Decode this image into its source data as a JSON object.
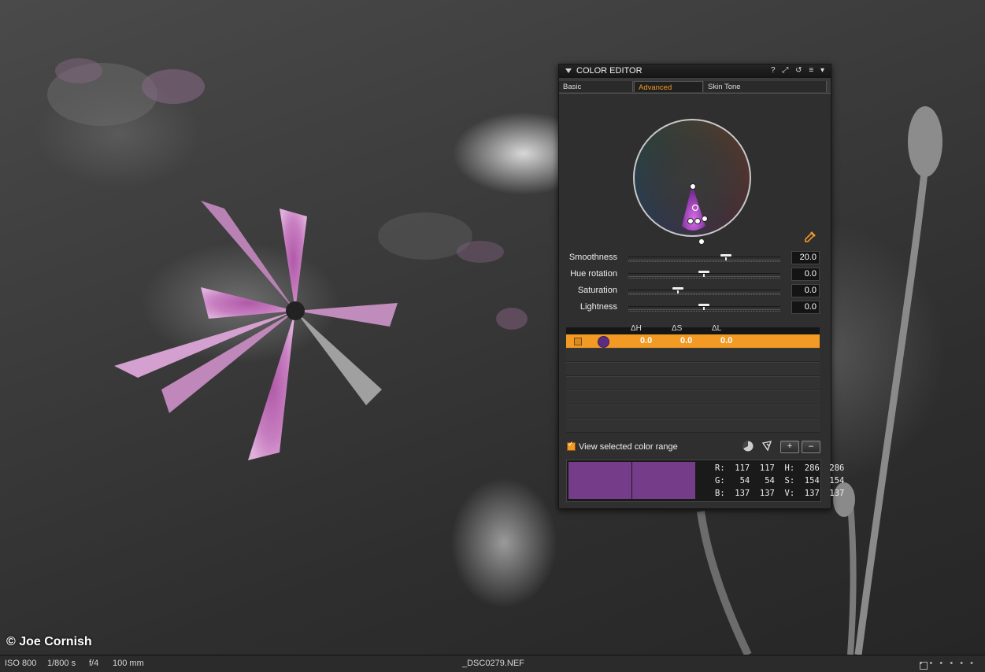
{
  "photo": {
    "credit": "© Joe Cornish"
  },
  "statusbar": {
    "iso": "ISO 800",
    "shutter": "1/800 s",
    "aperture": "f/4",
    "focal": "100 mm",
    "filename": "_DSC0279.NEF"
  },
  "panel": {
    "title": "COLOR EDITOR",
    "title_icons": [
      "?",
      "⤢",
      "↺",
      "≡"
    ],
    "tabs": [
      {
        "label": "Basic",
        "active": false
      },
      {
        "label": "Advanced",
        "active": true
      },
      {
        "label": "Skin Tone",
        "active": false
      }
    ],
    "sliders": [
      {
        "label": "Smoothness",
        "value": "20.0",
        "position": 0.65
      },
      {
        "label": "Hue rotation",
        "value": "0.0",
        "position": 0.5
      },
      {
        "label": "Saturation",
        "value": "0.0",
        "position": 0.33
      },
      {
        "label": "Lightness",
        "value": "0.0",
        "position": 0.5
      }
    ],
    "table": {
      "headers": [
        "ΔH",
        "ΔS",
        "ΔL"
      ],
      "selected_row": {
        "dh": "0.0",
        "ds": "0.0",
        "dl": "0.0",
        "color": "#5b2d82"
      },
      "empty_rows": 6
    },
    "view_selected_label": "View selected color range",
    "view_selected_checked": true,
    "add_label": "+",
    "remove_label": "–",
    "readout": {
      "r": "R:  117  117",
      "g": "G:   54   54",
      "b": "B:  137  137",
      "h": "H:  286  286",
      "s": "S:  154  154",
      "v": "V:  137  137"
    },
    "swatch_color": "#753c89",
    "accent": "#f29a24"
  }
}
